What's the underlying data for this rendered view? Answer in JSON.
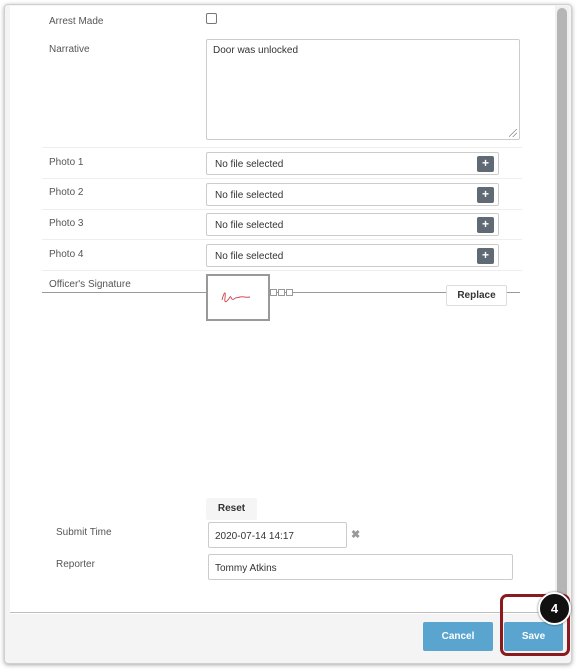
{
  "form": {
    "arrest_made_label": "Arrest Made",
    "narrative_label": "Narrative",
    "narrative_value": "Door was unlocked",
    "photos": [
      {
        "label": "Photo 1",
        "status": "No file selected",
        "add": "+"
      },
      {
        "label": "Photo 2",
        "status": "No file selected",
        "add": "+"
      },
      {
        "label": "Photo 3",
        "status": "No file selected",
        "add": "+"
      },
      {
        "label": "Photo 4",
        "status": "No file selected",
        "add": "+"
      }
    ],
    "signature_label": "Officer's Signature",
    "replace_label": "Replace",
    "reset_label": "Reset",
    "submit_time_label": "Submit Time",
    "submit_time_value": "2020-07-14 14:17",
    "clear_icon": "✖",
    "reporter_label": "Reporter",
    "reporter_value": "Tommy Atkins"
  },
  "footer": {
    "cancel_label": "Cancel",
    "save_label": "Save"
  },
  "annotation": {
    "step": "4"
  },
  "colors": {
    "primary_button": "#5aa5cf",
    "highlight": "#8b1a1f",
    "add_button": "#5f6a75",
    "signature_ink": "#d0505a"
  }
}
